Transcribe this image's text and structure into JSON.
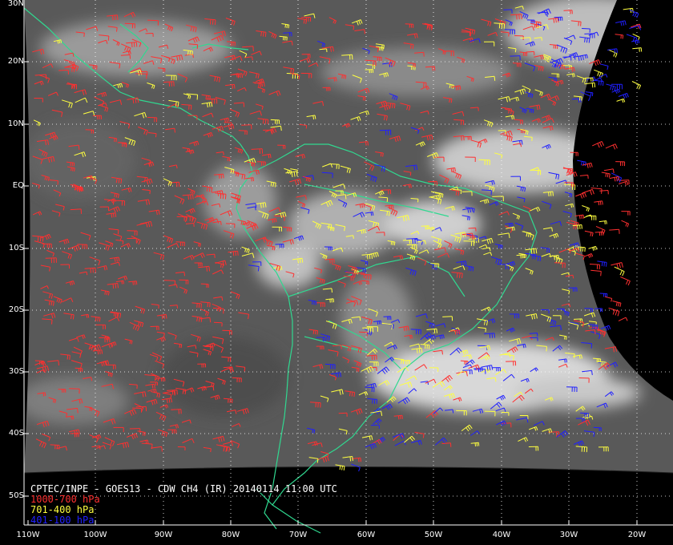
{
  "map": {
    "title": "CPTEC/INPE - GOES13 - CDW CH4 (IR) 20140114 11:00 UTC",
    "latitude_labels": [
      "30N",
      "20N",
      "10N",
      "EQ",
      "10S",
      "20S",
      "30S",
      "40S",
      "50S"
    ],
    "longitude_labels": [
      "110W",
      "100W",
      "90W",
      "80W",
      "70W",
      "60W",
      "50W",
      "40W",
      "30W",
      "20W"
    ],
    "legend": [
      {
        "label": "1000-700 hPa",
        "color": "#ff3030"
      },
      {
        "label": "701-400 hPa",
        "color": "#ffff40"
      },
      {
        "label": "401-100 hPa",
        "color": "#2020ff"
      }
    ],
    "colors": {
      "coastline": "#30d890",
      "graticule": "#ffffff",
      "background": "#000000",
      "cloud_bright": "#e8e8e8",
      "ocean_gray": "#5a5a5a"
    }
  }
}
